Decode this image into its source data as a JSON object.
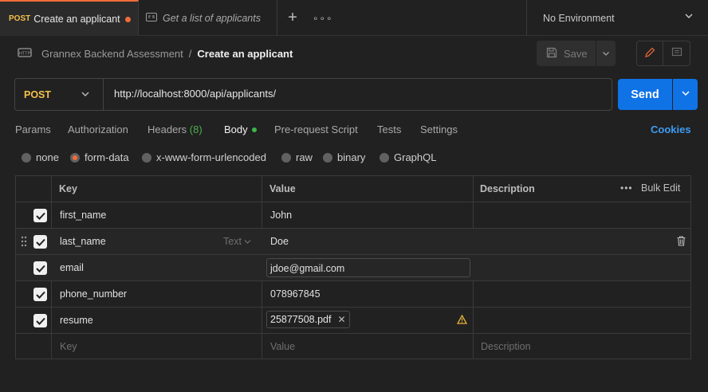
{
  "tabs": [
    {
      "method": "POST",
      "name": "Create an applicant",
      "unsaved": true
    },
    {
      "method_icon": "http-icon",
      "name": "Get a list of applicants"
    }
  ],
  "tabbar": {
    "new_tab_icon": "plus-icon",
    "more_icon": "ellipsis-icon"
  },
  "environment": {
    "label": "No Environment"
  },
  "breadcrumb": {
    "icon": "http-collection-icon",
    "collection": "Grannex Backend Assessment",
    "separator": "/",
    "current": "Create an applicant"
  },
  "toolbar": {
    "save_label": "Save"
  },
  "request": {
    "method": "POST",
    "url": "http://localhost:8000/api/applicants/",
    "send_label": "Send"
  },
  "request_tabs": {
    "params": "Params",
    "authorization": "Authorization",
    "headers": "Headers",
    "headers_count": "(8)",
    "body": "Body",
    "pre_request": "Pre-request Script",
    "tests": "Tests",
    "settings": "Settings",
    "cookies": "Cookies"
  },
  "body_types": {
    "none": "none",
    "form_data": "form-data",
    "urlencoded": "x-www-form-urlencoded",
    "raw": "raw",
    "binary": "binary",
    "graphql": "GraphQL",
    "selected": "form-data"
  },
  "table": {
    "headers": {
      "key": "Key",
      "value": "Value",
      "description": "Description",
      "bulk_edit": "Bulk Edit"
    },
    "rows": [
      {
        "key": "first_name",
        "value": "John",
        "checked": true
      },
      {
        "key": "last_name",
        "type": "Text",
        "value": "Doe",
        "checked": true
      },
      {
        "key": "email",
        "value": "jdoe@gmail.com",
        "checked": true
      },
      {
        "key": "phone_number",
        "value": "078967845",
        "checked": true
      },
      {
        "key": "resume",
        "value": "25877508.pdf",
        "checked": true,
        "is_file": true
      }
    ],
    "placeholders": {
      "key": "Key",
      "value": "Value",
      "description": "Description"
    }
  },
  "colors": {
    "accent": "#f26b3a",
    "send": "#0f73e6",
    "post": "#f5c04a",
    "link": "#3d9bf2",
    "headers_count": "#4caf50"
  }
}
